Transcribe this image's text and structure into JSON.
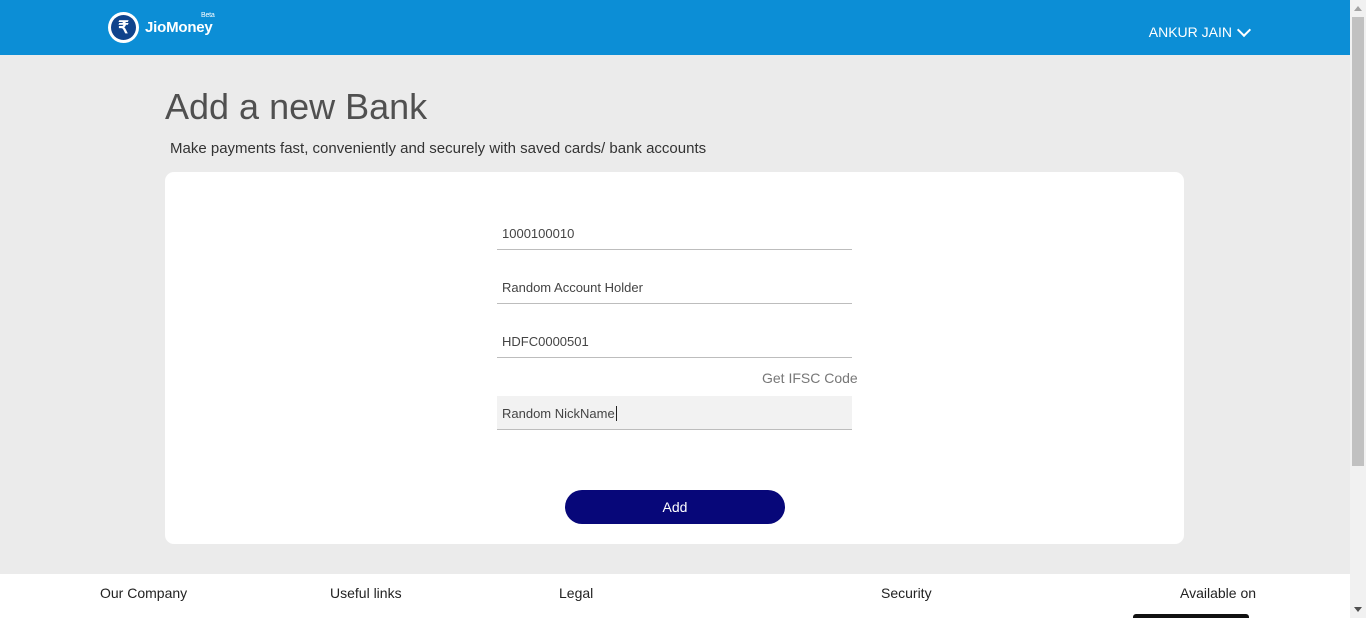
{
  "header": {
    "brand": "JioMoney",
    "beta": "Beta",
    "logo_symbol": "₹",
    "user_name": "ANKUR JAIN",
    "bg_color": "#0c8ed6"
  },
  "page": {
    "title": "Add a new Bank",
    "subtitle": "Make payments fast, conveniently and securely with saved cards/ bank accounts"
  },
  "form": {
    "account_number": "1000100010",
    "account_holder": "Random Account Holder",
    "ifsc": "HDFC0000501",
    "ifsc_link": "Get IFSC Code",
    "nickname": "Random NickName",
    "submit_label": "Add",
    "button_color": "#070779"
  },
  "footer": {
    "our_company": "Our Company",
    "useful_links": "Useful links",
    "legal": "Legal",
    "security": "Security",
    "available_on": "Available on"
  }
}
